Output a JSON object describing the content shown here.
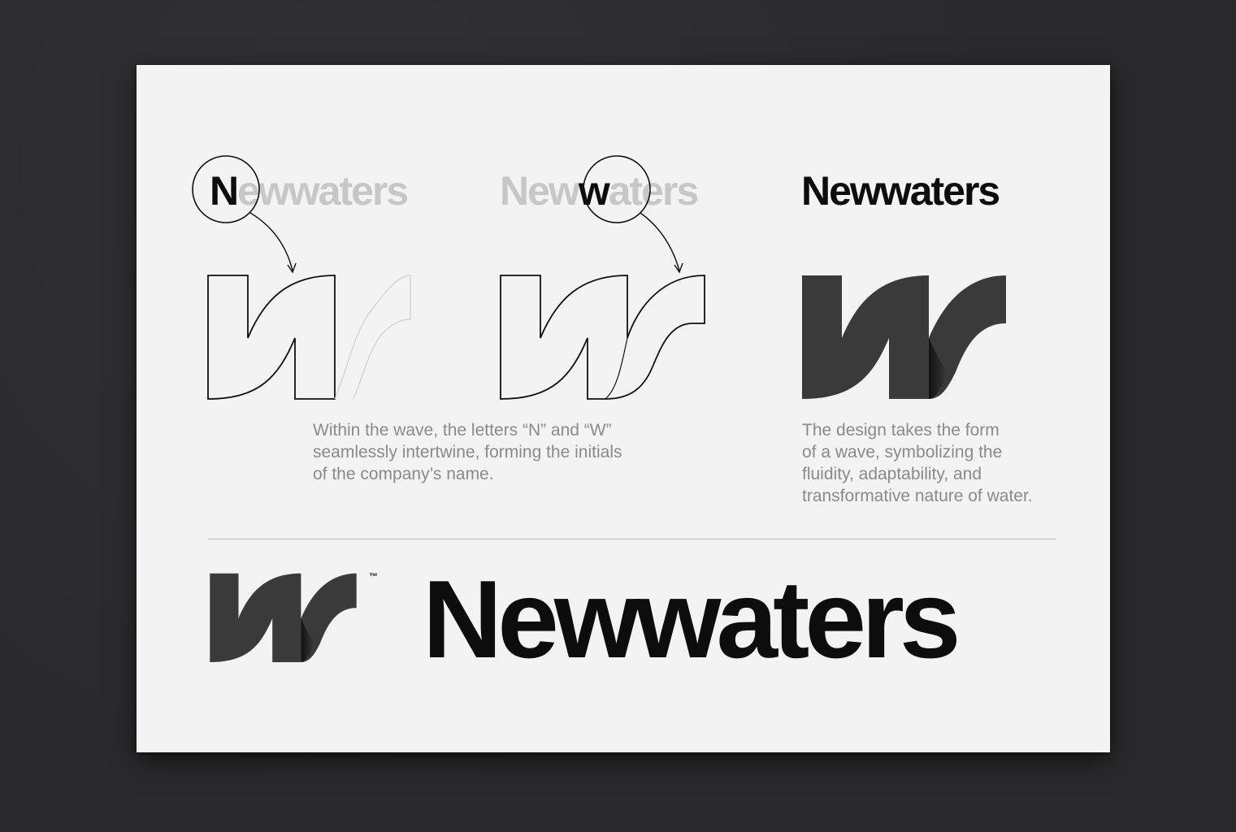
{
  "panel_1": {
    "first_letter": "N",
    "rest": "ewwaters"
  },
  "panel_2": {
    "before": "New",
    "highlight": "w",
    "after": "aters"
  },
  "panel_3": {
    "wordmark": "Newwaters"
  },
  "caption_left": [
    "Within the wave, the letters “N” and “W”",
    "seamlessly intertwine, forming the initials",
    "of the company’s name."
  ],
  "caption_right": [
    "The design takes the form",
    "of a wave, symbolizing the",
    "fluidity, adaptability, and",
    "transformative nature of water."
  ],
  "final_logo": {
    "trademark": "™",
    "wordmark": "Newwaters"
  },
  "colors": {
    "background": "#2a2a2c",
    "card": "#f3f3f3",
    "mark": "#3a3a3a",
    "text_dark": "#0d0d0d",
    "text_grey": "#c7c7c7",
    "caption": "#8a8a8a"
  }
}
